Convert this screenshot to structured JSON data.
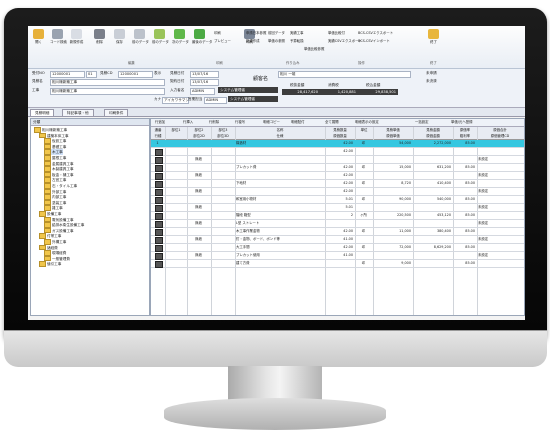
{
  "ribbon": {
    "buttons": [
      {
        "label": "開く",
        "icon": "open-folder-icon",
        "color": "#e7b13a"
      },
      {
        "label": "コード検索",
        "icon": "code-search-icon",
        "color": "#9aa3b0"
      },
      {
        "label": "新規作成",
        "icon": "new-doc-icon",
        "color": "#d9dde4"
      },
      {
        "label": "削除",
        "icon": "delete-icon",
        "color": "#7a7f8a"
      },
      {
        "label": "保存",
        "icon": "save-icon",
        "color": "#c9ced6"
      },
      {
        "label": "前のデータ",
        "icon": "prev-data-icon",
        "color": "#bcc2cb"
      },
      {
        "label": "前のデータ",
        "icon": "prev-arrow-icon",
        "color": "#9ac45a"
      },
      {
        "label": "次のデータ",
        "icon": "next-arrow-icon",
        "color": "#5fb84a"
      },
      {
        "label": "最後のデータ",
        "icon": "last-data-icon",
        "color": "#4caa44"
      },
      {
        "label": "印刷",
        "icon": "print-icon",
        "color": "#7a8596"
      },
      {
        "label": "終了",
        "icon": "exit-icon",
        "color": "#e8b63c"
      }
    ],
    "small_items": [
      "印刷",
      "プレビュー",
      "申請日本参照",
      "新規作成",
      "前回データ",
      "単価の参照",
      "実績工事",
      "予算転換",
      "単価比較参照",
      "単価比較付",
      "実績CSVエクスポート",
      "BCS-CSVエクスポート",
      "BCS-CSVインポート"
    ],
    "sections": [
      "編集",
      "印刷",
      "作り込み",
      "操作",
      "終了"
    ]
  },
  "header": {
    "row1": {
      "label1": "受付NO",
      "code": "12000001",
      "suffix": "01",
      "label2": "見積CD",
      "code2": "12000001",
      "label3": "表示",
      "label4": "見積日付",
      "date": "13/07/16",
      "label5": "顧客名",
      "customer": "相川 一雄",
      "status": "未申請"
    },
    "row2": {
      "label": "見積名",
      "name": "相川様新築工事",
      "label_kd": "契約日付",
      "kd": "13/07/16",
      "status2": "未決済"
    },
    "row3": {
      "label": "工事",
      "name": "相川様新築工事",
      "label_in": "入力者名",
      "user1": "ADMIN",
      "dept1": "システム管理者",
      "label_tot": "税抜金額",
      "total": "28,417,620",
      "label_tax": "消費税",
      "tax": "1,420,881",
      "label_inc": "税込金額",
      "total_inc": "29,838,501"
    },
    "row4": {
      "label_kana": "カナ",
      "kana": "アイカワサマシンチク",
      "label_sales": "営業担当",
      "user2": "ADMIN",
      "dept2": "システム管理者"
    }
  },
  "tabs": [
    "見積明細",
    "特記事項・他",
    "印刷条件"
  ],
  "tree": {
    "header": "分類",
    "items": [
      {
        "label": "相川様新築工事",
        "level": 0
      },
      {
        "label": "建築本体工事",
        "level": 1
      },
      {
        "label": "仮設工事",
        "level": 2
      },
      {
        "label": "基礎工事",
        "level": 2
      },
      {
        "label": "木工事",
        "level": 2,
        "selected": true
      },
      {
        "label": "屋根工事",
        "level": 2
      },
      {
        "label": "金属建具工事",
        "level": 2
      },
      {
        "label": "木製建具工事",
        "level": 2
      },
      {
        "label": "板金・樋工事",
        "level": 2
      },
      {
        "label": "左官工事",
        "level": 2
      },
      {
        "label": "石・タイル工事",
        "level": 2
      },
      {
        "label": "外部工事",
        "level": 2
      },
      {
        "label": "内部工事",
        "level": 2
      },
      {
        "label": "塗装工事",
        "level": 2
      },
      {
        "label": "雑工事",
        "level": 2
      },
      {
        "label": "設備工事",
        "level": 1
      },
      {
        "label": "電気設備工事",
        "level": 2
      },
      {
        "label": "給排水衛生設備工事",
        "level": 2
      },
      {
        "label": "ガス設備工事",
        "level": 2
      },
      {
        "label": "付帯工事",
        "level": 1
      },
      {
        "label": "外構工事",
        "level": 2
      },
      {
        "label": "諸経費",
        "level": 1
      },
      {
        "label": "現場経費",
        "level": 2
      },
      {
        "label": "一般管理費",
        "level": 2
      },
      {
        "label": "値引工事",
        "level": 1
      }
    ]
  },
  "grid": {
    "toolbar": [
      "行追加",
      "行挿入",
      "行削除",
      "行複写",
      "明細コピー",
      "明細貼付",
      "全て展開",
      "明細表示の設定",
      "一括設定",
      "単価/元へ登録"
    ],
    "headers": [
      "通番",
      "部位1",
      "部位2",
      "部位3",
      "名称",
      "見積数量",
      "単位",
      "見積単価",
      "見積金額",
      "原価率",
      "原価合計"
    ],
    "subheaders": [
      "行種",
      "",
      "部位2D",
      "部位3D",
      "仕様",
      "原価数量",
      "",
      "原価単価",
      "原価金額",
      "粗利率",
      "原価管理CD"
    ],
    "rows": [
      {
        "no": "1",
        "b2": "",
        "name": "構造材",
        "qty": "42.00",
        "unit": "坪",
        "price": "54,000",
        "amount": "2,272,000",
        "rate": "85.00",
        "mark": ""
      },
      {
        "no": "",
        "b2": "",
        "name": "",
        "qty": "42.00",
        "unit": "",
        "price": "",
        "amount": "",
        "rate": "",
        "mark": ""
      },
      {
        "no": "",
        "b2": "無垢",
        "name": "",
        "qty": "",
        "unit": "",
        "price": "",
        "amount": "",
        "rate": "",
        "mark": "未設定"
      },
      {
        "no": "",
        "b2": "",
        "name": "プレカット費",
        "qty": "42.00",
        "unit": "坪",
        "price": "15,000",
        "amount": "631,200",
        "rate": "85.00",
        "mark": ""
      },
      {
        "no": "",
        "b2": "無垢",
        "name": "",
        "qty": "42.00",
        "unit": "",
        "price": "",
        "amount": "",
        "rate": "",
        "mark": "未設定"
      },
      {
        "no": "",
        "b2": "",
        "name": "下地材",
        "qty": "42.00",
        "unit": "坪",
        "price": "8,720",
        "amount": "410,400",
        "rate": "85.00",
        "mark": ""
      },
      {
        "no": "",
        "b2": "無垢",
        "name": "",
        "qty": "42.00",
        "unit": "",
        "price": "",
        "amount": "",
        "rate": "",
        "mark": "未設定"
      },
      {
        "no": "",
        "b2": "",
        "name": "和室用小物材",
        "qty": "5.01",
        "unit": "坪",
        "price": "90,000",
        "amount": "540,000",
        "rate": "85.00",
        "mark": ""
      },
      {
        "no": "",
        "b2": "無垢",
        "name": "",
        "qty": "5.01",
        "unit": "",
        "price": "",
        "amount": "",
        "rate": "",
        "mark": "未設定"
      },
      {
        "no": "",
        "b2": "",
        "name": "階段 箱型",
        "qty": "2",
        "unit": "ヶ所",
        "price": "220,500",
        "amount": "453,120",
        "rate": "85.00",
        "mark": ""
      },
      {
        "no": "",
        "b2": "無垢",
        "name": "L型 ストレート",
        "qty": "",
        "unit": "",
        "price": "",
        "amount": "",
        "rate": "",
        "mark": "未設定"
      },
      {
        "no": "",
        "b2": "",
        "name": "木工事作業金物",
        "qty": "42.00",
        "unit": "坪",
        "price": "11,000",
        "amount": "380,400",
        "rate": "85.00",
        "mark": ""
      },
      {
        "no": "",
        "b2": "無垢",
        "name": "釘・金物、ボード、ボンド等",
        "qty": "41.00",
        "unit": "",
        "price": "",
        "amount": "",
        "rate": "",
        "mark": "未設定"
      },
      {
        "no": "",
        "b2": "",
        "name": "大工手間",
        "qty": "42.00",
        "unit": "坪",
        "price": "72,000",
        "amount": "8,629,200",
        "rate": "85.00",
        "mark": ""
      },
      {
        "no": "",
        "b2": "無垢",
        "name": "プレカット使用",
        "qty": "41.00",
        "unit": "",
        "price": "",
        "amount": "",
        "rate": "",
        "mark": "未設定"
      },
      {
        "no": "",
        "b2": "",
        "name": "建て方費",
        "qty": "",
        "unit": "坪",
        "price": "9,000",
        "amount": "",
        "rate": "85.00",
        "mark": ""
      }
    ]
  },
  "colors": {
    "highlight": "#35c7e0",
    "monitor": "#111111",
    "folder": "#f1c64b"
  }
}
